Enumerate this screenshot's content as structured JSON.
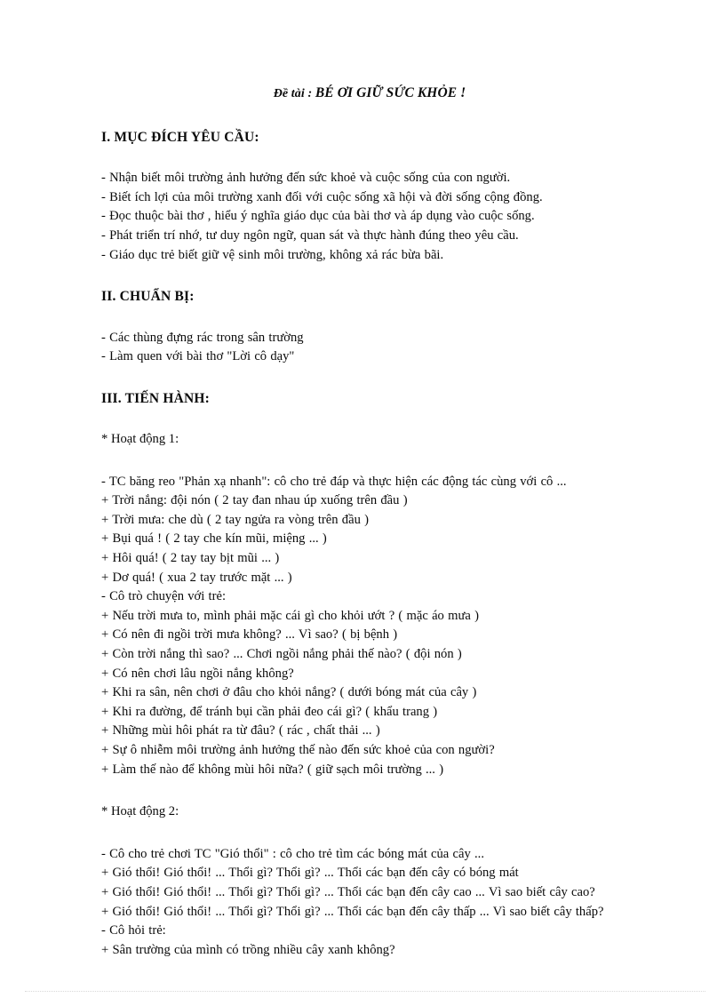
{
  "document": {
    "title_lead": "Đề tài : ",
    "title_main": "BÉ ƠI GIỮ SỨC KHỎE !"
  },
  "sections": {
    "purpose": {
      "heading": "I. MỤC ĐÍCH YÊU CẦU:",
      "lines": [
        "- Nhận biết môi trường ảnh hưởng đến sức khoẻ và cuộc sống của con người.",
        "- Biết ích lợi của môi trường xanh đối với cuộc sống xã hội và đời sống cộng đồng.",
        "- Đọc thuộc bài thơ , hiểu ý nghĩa giáo dục của bài thơ và áp dụng vào cuộc sống.",
        "- Phát triển trí nhớ, tư duy ngôn ngữ, quan sát và thực hành đúng theo yêu cầu.",
        "- Giáo dục trẻ biết giữ vệ sinh môi trường, không xả rác bừa bãi."
      ]
    },
    "preparation": {
      "heading": "II. CHUẨN BỊ:",
      "lines": [
        "- Các thùng  đựng rác trong  sân trường",
        "- Làm  quen với  bài thơ \"Lời  cô dạy\""
      ]
    },
    "procedure": {
      "heading": "III. TIẾN HÀNH:",
      "activity1": {
        "subheading": "* Hoạt động 1:",
        "lines": [
          "- TC băng reo \"Phản  xạ nhanh\":  cô cho trẻ đáp và thực hiện các động tác cùng với cô ...",
          "+ Trời nắng:  đội nón ( 2 tay đan nhau úp xuống  trên đầu )",
          "+ Trời mưa: che dù ( 2 tay ngửa ra vòng trên đầu )",
          "+ Bụi quá ! ( 2 tay che kín mũi, miệng  ... )",
          "+ Hôi quá! ( 2 tay tay bịt mũi  ... )",
          "+ Dơ quá! ( xua 2 tay trước mặt ... )",
          "- Cô trò chuyện với trẻ:",
          "+ Nếu trời mưa to, mình  phải mặc cái gì cho khỏi ướt ? ( mặc áo mưa )",
          "+ Có nên đi ngồi  trời mưa không? ... Vì sao? ( bị bệnh )",
          "+ Còn trời nắng thì sao? ... Chơi ngồi  nắng phải thế nào? ( đội nón )",
          "+ Có nên chơi lâu ngồi  nắng không?",
          "+ Khi ra sân, nên chơi ở đâu cho khỏi nắng? ( dưới bóng mát của cây )",
          "+ Khi ra đường, để tránh bụi cần phải đeo cái gì? ( khẩu trang )",
          "+ Những mùi  hôi phát ra từ đâu? ( rác , chất thải ... )",
          "+ Sự ô nhiễm  môi trường ảnh hưởng  thế nào đến sức khoẻ của con người?",
          "+ Làm thế nào để không mùi  hôi nữa? ( giữ sạch môi trường ... )"
        ]
      },
      "activity2": {
        "subheading": "* Hoạt động 2:",
        "lines": [
          "- Cô cho trẻ chơi TC \"Gió  thổi\" : cô cho trẻ tìm các bóng mát của cây ...",
          "+ Gió thổi! Gió thổi! ... Thổi  gì? Thổi gì? ... Thổi các bạn đến cây có bóng mát",
          "+ Gió thổi! Gió thổi! ... Thổi  gì? Thổi gì? ... Thổi các bạn đến cây cao ... Vì sao biết cây cao?",
          "+ Gió thổi! Gió thổi! ... Thổi  gì? Thổi gì? ... Thổi các bạn đến cây thấp ... Vì sao biết cây thấp?",
          "- Cô hỏi trẻ:",
          "+ Sân trường của mình  có trồng nhiều  cây xanh không?"
        ]
      }
    }
  }
}
